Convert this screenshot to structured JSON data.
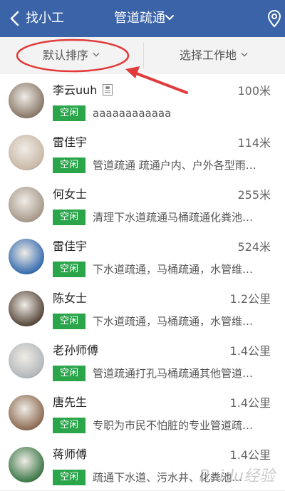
{
  "header": {
    "back_label": "找小工",
    "title": "管道疏通",
    "bg_color": "#3b63a8"
  },
  "filters": {
    "sort_label": "默认排序",
    "area_label": "选择工作地"
  },
  "annotation_color": "#e23b3b",
  "badge_color": "#2aa54a",
  "workers": [
    {
      "name": "李云uuh",
      "verified": true,
      "distance": "100米",
      "status": "空闲",
      "desc": "aaaaaaaaaaaa",
      "avatar_color": "#8a7a6a"
    },
    {
      "name": "雷佳宇",
      "verified": false,
      "distance": "114米",
      "status": "空闲",
      "desc": "管道疏通 疏通户内、户外各型雨…",
      "avatar_color": "#c9b9a8"
    },
    {
      "name": "何女士",
      "verified": false,
      "distance": "255米",
      "status": "空闲",
      "desc": "清理下水道疏通马桶疏通化粪池…",
      "avatar_color": "#a89a8c"
    },
    {
      "name": "雷佳宇",
      "verified": false,
      "distance": "524米",
      "status": "空闲",
      "desc": "下水道疏通，马桶疏通，水管维…",
      "avatar_color": "#3a6fb0"
    },
    {
      "name": "陈女士",
      "verified": false,
      "distance": "1.2公里",
      "status": "空闲",
      "desc": "下水道疏通，马桶疏通，水管维…",
      "avatar_color": "#5a4a3e"
    },
    {
      "name": "老孙师傅",
      "verified": false,
      "distance": "1.4公里",
      "status": "空闲",
      "desc": "管道疏通打孔马桶疏通其他管道…",
      "avatar_color": "#b3b8bc"
    },
    {
      "name": "唐先生",
      "verified": false,
      "distance": "1.4公里",
      "status": "空闲",
      "desc": "专职为市民不怕脏的专业管道疏…",
      "avatar_color": "#8e6e55"
    },
    {
      "name": "蒋师傅",
      "verified": false,
      "distance": "1.4公里",
      "status": "空闲",
      "desc": "疏通下水道、污水井、化粪池…",
      "avatar_color": "#3f7a4a"
    }
  ],
  "watermark": "Baidu经验"
}
